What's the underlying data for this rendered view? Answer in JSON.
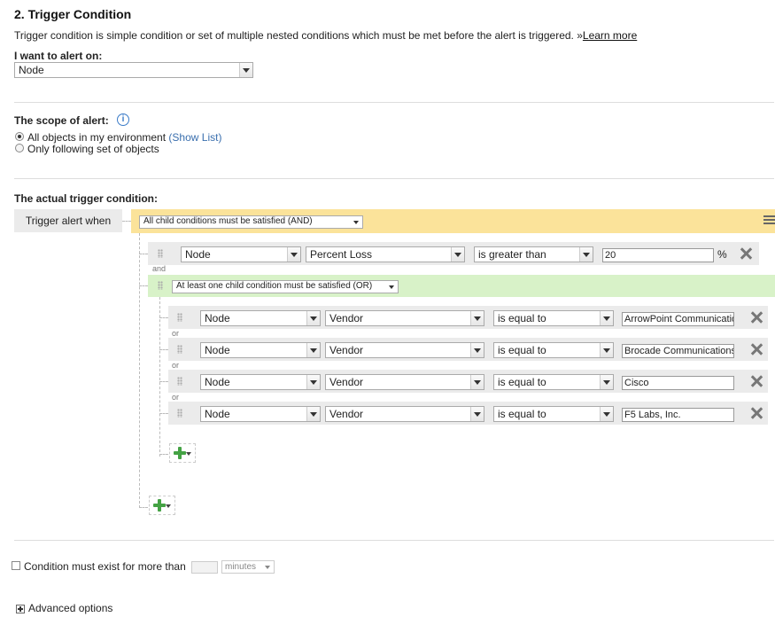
{
  "section": {
    "title": "2. Trigger Condition"
  },
  "intro": {
    "text": "Trigger condition is simple condition or set of multiple nested conditions which must be met before the alert is triggered. »",
    "link": "Learn more"
  },
  "alert_on": {
    "label": "I want to alert on:",
    "value": "Node"
  },
  "scope": {
    "label": "The scope of alert:",
    "options": [
      {
        "label": "All objects in my environment",
        "selected": true
      },
      {
        "label": "Only following set of objects",
        "selected": false
      }
    ],
    "show_list": "(Show List)"
  },
  "trigger": {
    "label": "The actual trigger condition:",
    "when_label": "Trigger alert when",
    "and_group": "All child conditions must be satisfied (AND)",
    "first_condition": {
      "object": "Node",
      "field": "Percent Loss",
      "operator": "is greater than",
      "value": "20",
      "unit": "%"
    },
    "connector_and": "and",
    "or_group": "At least one child condition must be satisfied (OR)",
    "connector_or": "or",
    "or_conditions": [
      {
        "object": "Node",
        "field": "Vendor",
        "operator": "is equal to",
        "value": "ArrowPoint Communicatio"
      },
      {
        "object": "Node",
        "field": "Vendor",
        "operator": "is equal to",
        "value": "Brocade Communications"
      },
      {
        "object": "Node",
        "field": "Vendor",
        "operator": "is equal to",
        "value": "Cisco"
      },
      {
        "object": "Node",
        "field": "Vendor",
        "operator": "is equal to",
        "value": "F5 Labs, Inc."
      }
    ]
  },
  "duration": {
    "label": "Condition must exist for more than",
    "value": "",
    "unit": "minutes"
  },
  "advanced": {
    "label": "Advanced options"
  },
  "colors": {
    "and_bg": "#fbe39a",
    "or_bg": "#d8f2c8",
    "row_bg": "#ebebeb",
    "add_green": "#44a244"
  }
}
